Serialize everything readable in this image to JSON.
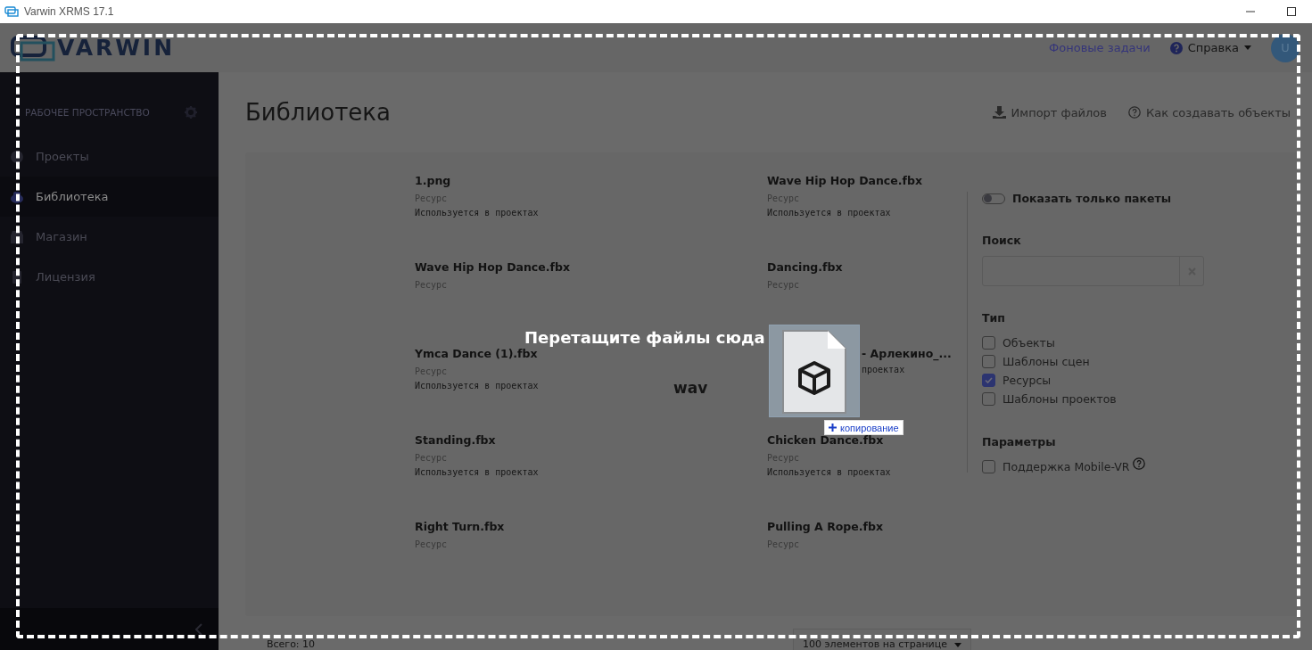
{
  "window": {
    "title": "Varwin XRMS 17.1"
  },
  "header": {
    "logo_text": "VARWIN",
    "background_tasks": "Фоновые задачи",
    "help": "Справка",
    "avatar": "U"
  },
  "sidebar": {
    "section_title": "РАБОЧЕЕ ПРОСТРАНСТВО",
    "items": [
      {
        "label": "Проекты",
        "selected": false,
        "kind": "projects"
      },
      {
        "label": "Библиотека",
        "selected": true,
        "kind": "library"
      },
      {
        "label": "Магазин",
        "selected": false,
        "kind": "store"
      },
      {
        "label": "Лицензия",
        "selected": false,
        "kind": "license"
      }
    ]
  },
  "page": {
    "title": "Библиотека",
    "actions": [
      {
        "label": "Импорт файлов",
        "kind": "import"
      },
      {
        "label": "Как создавать объекты",
        "kind": "help"
      }
    ]
  },
  "items": [
    {
      "name": "1.png",
      "type": "Ресурс",
      "usage": "Используется в проектах"
    },
    {
      "name": "Wave Hip Hop Dance.fbx",
      "type": "Ресурс",
      "usage": "Используется в проектах"
    },
    {
      "name": "Wave Hip Hop Dance.fbx",
      "type": "Ресурс"
    },
    {
      "name": "Dancing.fbx",
      "type": "Ресурс"
    },
    {
      "name": "Ymca Dance (1).fbx",
      "type": "Ресурс",
      "usage": "Используется в проектах"
    },
    {
      "name": "- Арлекино_...",
      "usage": "проектах",
      "covered": true
    },
    {
      "name": "Standing.fbx",
      "type": "Ресурс",
      "usage": "Используется в проектах"
    },
    {
      "name": "Chicken Dance.fbx",
      "type": "Ресурс",
      "usage": "Используется в проектах"
    },
    {
      "name": "Right Turn.fbx",
      "type": "Ресурс"
    },
    {
      "name": "Pulling A Rope.fbx",
      "type": "Ресурс"
    }
  ],
  "filters": {
    "toggle": {
      "label": "Показать только пакеты",
      "on": false
    },
    "search": {
      "label": "Поиск"
    },
    "type": {
      "label": "Тип",
      "options": [
        {
          "label": "Объекты",
          "checked": false
        },
        {
          "label": "Шаблоны сцен",
          "checked": false
        },
        {
          "label": "Ресурсы",
          "checked": true
        },
        {
          "label": "Шаблоны проектов",
          "checked": false
        }
      ]
    },
    "params": {
      "label": "Параметры",
      "options": [
        {
          "label": "Поддержка Mobile-VR",
          "checked": false,
          "help": true
        }
      ]
    }
  },
  "footer": {
    "total": "Всего: 10",
    "page_size": "100 элементов на странице"
  },
  "drop_overlay": {
    "message": "Перетащите файлы сюда",
    "ghost_label": "wav",
    "drop_effect": "копирование"
  }
}
